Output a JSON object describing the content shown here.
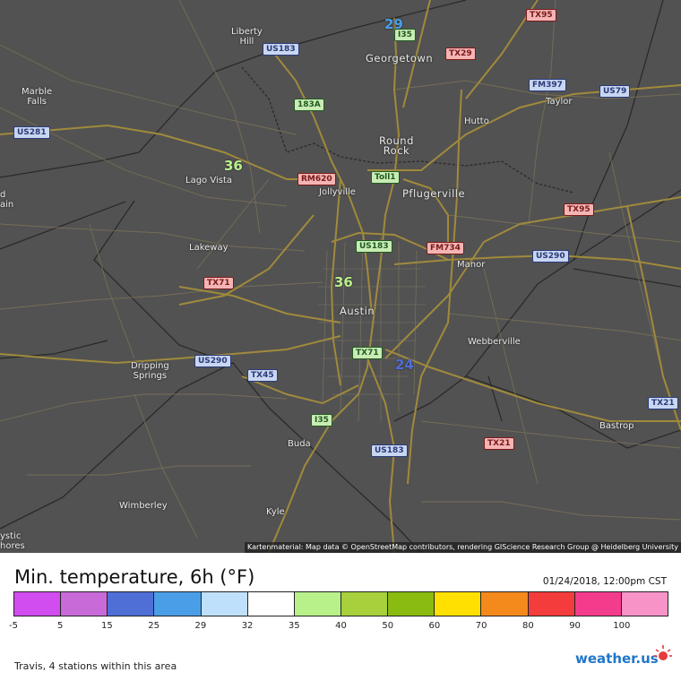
{
  "map": {
    "towns": [
      {
        "name": "Liberty\nHill",
        "id": "liberty-hill"
      },
      {
        "name": "Georgetown",
        "id": "georgetown"
      },
      {
        "name": "Marble\nFalls",
        "id": "marble-falls"
      },
      {
        "name": "Taylor",
        "id": "taylor"
      },
      {
        "name": "Hutto",
        "id": "hutto"
      },
      {
        "name": "Round\nRock",
        "id": "round-rock"
      },
      {
        "name": "Lago Vista",
        "id": "lago-vista"
      },
      {
        "name": "Jollyville",
        "id": "jollyville"
      },
      {
        "name": "Pflugerville",
        "id": "pflugerville"
      },
      {
        "name": "Lakeway",
        "id": "lakeway"
      },
      {
        "name": "Manor",
        "id": "manor"
      },
      {
        "name": "Austin",
        "id": "austin"
      },
      {
        "name": "Webberville",
        "id": "webberville"
      },
      {
        "name": "Dripping\nSprings",
        "id": "dripping-springs"
      },
      {
        "name": "Bastrop",
        "id": "bastrop"
      },
      {
        "name": "Buda",
        "id": "buda"
      },
      {
        "name": "Wimberley",
        "id": "wimberley"
      },
      {
        "name": "Kyle",
        "id": "kyle"
      },
      {
        "name": "d\nain",
        "id": "edge-west-1"
      },
      {
        "name": "ystic\nhores",
        "id": "edge-west-2"
      }
    ],
    "shields": [
      {
        "label": "US183",
        "kind": "us"
      },
      {
        "label": "I35",
        "kind": "hw"
      },
      {
        "label": "TX29",
        "kind": "st"
      },
      {
        "label": "TX95",
        "kind": "st"
      },
      {
        "label": "FM397",
        "kind": "us"
      },
      {
        "label": "US79",
        "kind": "us"
      },
      {
        "label": "US281",
        "kind": "us"
      },
      {
        "label": "183A",
        "kind": "hw"
      },
      {
        "label": "RM620",
        "kind": "st"
      },
      {
        "label": "Toll1",
        "kind": "hw"
      },
      {
        "label": "TX95",
        "kind": "st"
      },
      {
        "label": "US183",
        "kind": "hw"
      },
      {
        "label": "FM734",
        "kind": "st"
      },
      {
        "label": "US290",
        "kind": "us"
      },
      {
        "label": "TX71",
        "kind": "st"
      },
      {
        "label": "TX71",
        "kind": "hw"
      },
      {
        "label": "US290",
        "kind": "us"
      },
      {
        "label": "TX45",
        "kind": "us"
      },
      {
        "label": "I35",
        "kind": "hw"
      },
      {
        "label": "TX21",
        "kind": "st"
      },
      {
        "label": "US183",
        "kind": "us"
      },
      {
        "label": "TX21",
        "kind": "us"
      }
    ],
    "stations": [
      {
        "value": "29",
        "color": "#4a9ee8"
      },
      {
        "value": "36",
        "color": "#b8f08a"
      },
      {
        "value": "36",
        "color": "#b8f08a"
      },
      {
        "value": "24",
        "color": "#4f6fd6"
      }
    ],
    "attribution": "Kartenmaterial: Map data © OpenStreetMap contributors, rendering GIScience Research Group @ Heidelberg University"
  },
  "legend": {
    "title": "Min. temperature, 6h (°F)",
    "timestamp": "01/24/2018, 12:00pm CST",
    "colors": [
      "#d14df0",
      "#c86ad8",
      "#4f6fd6",
      "#4a9ee8",
      "#bfe0fb",
      "#ffffff",
      "#b8f08a",
      "#a8cf3c",
      "#8abb10",
      "#ffe000",
      "#f48a1c",
      "#f43c3c",
      "#f43c8c",
      "#f893c8"
    ],
    "ticks": [
      "-5",
      "5",
      "15",
      "25",
      "29",
      "32",
      "35",
      "40",
      "50",
      "60",
      "70",
      "80",
      "90",
      "100"
    ],
    "station_count": "Travis, 4 stations within this area"
  },
  "brand": {
    "name": "weather.us"
  }
}
